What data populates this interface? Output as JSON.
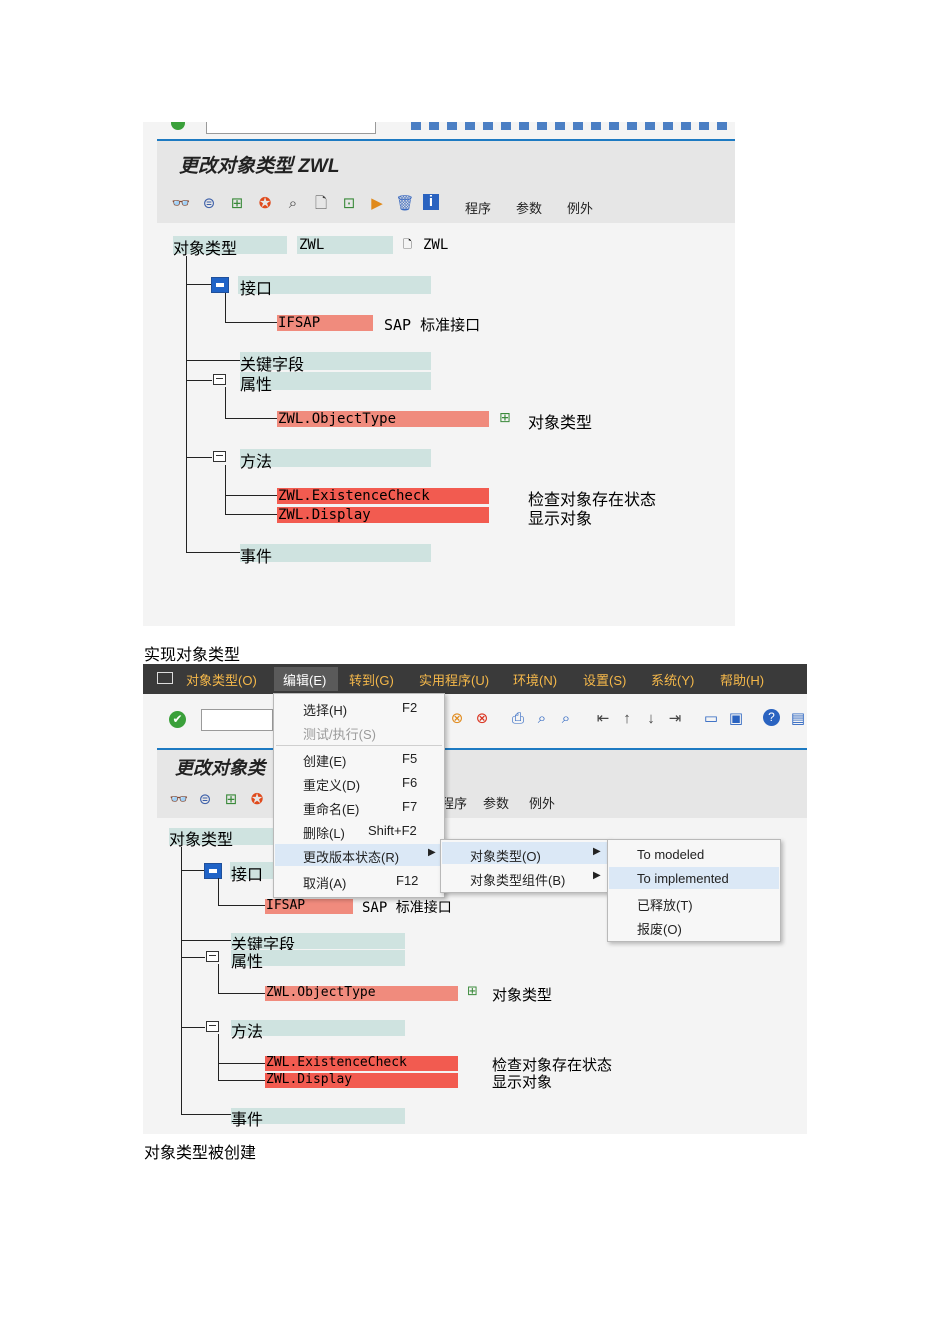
{
  "shot1": {
    "title": "更改对象类型 ZWL",
    "toolbar_texts": [
      "程序",
      "参数",
      "例外"
    ],
    "object_type_label": "对象类型",
    "object_type_value": "ZWL",
    "object_type_desc": "ZWL",
    "nodes": {
      "interface": "接口",
      "ifsap": "IFSAP",
      "ifsap_desc": "SAP 标准接口",
      "key_fields": "关键字段",
      "attributes": "属性",
      "objecttype": "ZWL.ObjectType",
      "objecttype_desc": "对象类型",
      "methods": "方法",
      "existence": "ZWL.ExistenceCheck",
      "existence_desc": "检查对象存在状态",
      "display": "ZWL.Display",
      "display_desc": "显示对象",
      "events": "事件"
    }
  },
  "caption1": "实现对象类型",
  "shot2": {
    "menubar": [
      "对象类型(O)",
      "编辑(E)",
      "转到(G)",
      "实用程序(U)",
      "环境(N)",
      "设置(S)",
      "系统(Y)",
      "帮助(H)"
    ],
    "title": "更改对象类",
    "toolbar_texts": [
      "程序",
      "参数",
      "例外"
    ],
    "edit_menu": [
      {
        "label": "选择(H)",
        "key": "F2"
      },
      {
        "label": "测试/执行(S)",
        "key": ""
      },
      {
        "label": "创建(E)",
        "key": "F5"
      },
      {
        "label": "重定义(D)",
        "key": "F6"
      },
      {
        "label": "重命名(E)",
        "key": "F7"
      },
      {
        "label": "删除(L)",
        "key": "Shift+F2"
      },
      {
        "label": "更改版本状态(R)",
        "key": "▶"
      },
      {
        "label": "取消(A)",
        "key": "F12"
      }
    ],
    "submenu": [
      {
        "label": "对象类型(O)",
        "key": "▶"
      },
      {
        "label": "对象类型组件(B)",
        "key": "▶"
      }
    ],
    "submenu2": [
      "To modeled",
      "To implemented",
      "已释放(T)",
      "报废(O)"
    ],
    "object_type_label": "对象类型",
    "nodes": {
      "interface": "接口",
      "ifsap": "IFSAP",
      "ifsap_desc": "SAP 标准接口",
      "key_fields": "关键字段",
      "attributes": "属性",
      "objecttype": "ZWL.ObjectType",
      "objecttype_desc": "对象类型",
      "methods": "方法",
      "existence": "ZWL.ExistenceCheck",
      "existence_desc": "检查对象存在状态",
      "display": "ZWL.Display",
      "display_desc": "显示对象",
      "events": "事件"
    }
  },
  "caption2": "对象类型被创建"
}
